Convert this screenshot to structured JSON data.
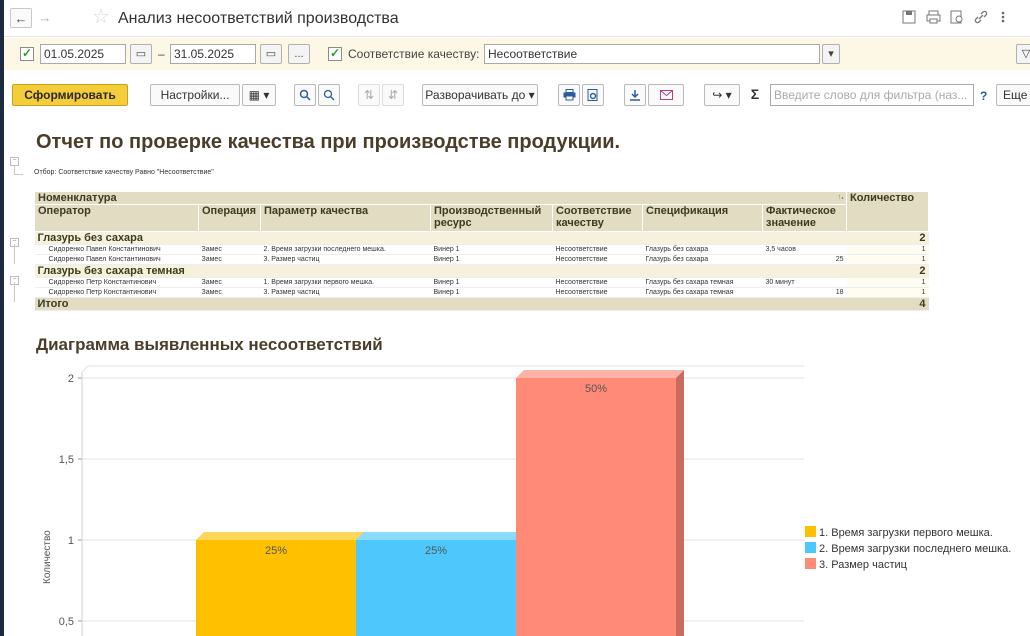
{
  "window": {
    "title": "Анализ несоответствий производства",
    "nav_back": "←",
    "nav_forward": "→",
    "star": "☆",
    "icons": [
      "save-icon",
      "print-icon",
      "preview-icon",
      "link-icon",
      "more-icon"
    ]
  },
  "filter": {
    "period_enabled": "✓",
    "date_from": "01.05.2025",
    "date_sep": "–",
    "date_to": "31.05.2025",
    "calendar_glyph": "▭",
    "period_button": "...",
    "quality_enabled": "✓",
    "quality_label": "Соответствие качеству:",
    "quality_value": "Несоответствие",
    "dropdown_glyph": "▾",
    "funnel_glyph": "▽"
  },
  "toolbar": {
    "generate_label": "Сформировать",
    "settings_label": "Настройки...",
    "variant_glyph": "▦ ▾",
    "search_glyph": "🔍",
    "search_next_glyph": "⟳",
    "sort_glyph": "⇅",
    "sort2_glyph": "⇵",
    "expand_label": "Разворачивать до",
    "expand_arrow": "▾",
    "print_glyph": "⎙",
    "preview_glyph": "🗋",
    "export_glyph": "⤓",
    "mail_glyph": "✉ ▾",
    "share_glyph": "↪ ▾",
    "sum_glyph": "Σ",
    "filter_placeholder": "Введите слово для фильтра (наз...",
    "help_label": "?",
    "more_label": "Еще"
  },
  "report": {
    "title": "Отчет по проверке качества при производстве продукции.",
    "filter_line": "Отбор:  Соответствие качеству Равно \"Несоответствие\"",
    "headers": {
      "nomenclature": "Номенклатура",
      "operator": "Оператор",
      "operation": "Операция",
      "parameter": "Параметр качества",
      "resource": "Производственный ресурс",
      "conformity": "Соответствие качеству",
      "spec": "Спецификация",
      "actual": "Фактическое значение",
      "quantity": "Количество",
      "sort_mark": "↑₁"
    },
    "groups": [
      {
        "name": "Глазурь без сахара",
        "qty": "2",
        "rows": [
          {
            "operator": "Сидоренко Павел Константинович",
            "operation": "Замес",
            "parameter": "2. Время загрузки последнего мешка.",
            "resource": "Винер 1",
            "conformity": "Несоответствие",
            "spec": "Глазурь без сахара",
            "actual": "3,5 часов",
            "qty": "1"
          },
          {
            "operator": "Сидоренко Павел Константинович",
            "operation": "Замес",
            "parameter": "3. Размер частиц",
            "resource": "Винер 1",
            "conformity": "Несоответствие",
            "spec": "Глазурь без сахара",
            "actual": "25",
            "qty": "1"
          }
        ]
      },
      {
        "name": "Глазурь без сахара темная",
        "qty": "2",
        "rows": [
          {
            "operator": "Сидоренко Петр Константинович",
            "operation": "Замес",
            "parameter": "1. Время загрузки первого мешка.",
            "resource": "Винер 1",
            "conformity": "Несоответствие",
            "spec": "Глазурь без сахара темная",
            "actual": "30 минут",
            "qty": "1"
          },
          {
            "operator": "Сидоренко Петр Константинович",
            "operation": "Замес",
            "parameter": "3. Размер частиц",
            "resource": "Винер 1",
            "conformity": "Несоответствие",
            "spec": "Глазурь без сахара темная",
            "actual": "18",
            "qty": "1"
          }
        ]
      }
    ],
    "total_label": "Итого",
    "total_qty": "4",
    "chart_title": "Диаграмма выявленных несоответствий"
  },
  "chart_data": {
    "type": "bar",
    "title": "",
    "ylabel": "Количество",
    "xlabel": "",
    "ylim": [
      0,
      2
    ],
    "yticks": [
      "0,5",
      "1",
      "1,5",
      "2"
    ],
    "grid": true,
    "legend_position": "right",
    "series": [
      {
        "name": "1. Время загрузки первого мешка.",
        "value": 1,
        "label": "25%",
        "color": "#ffc000"
      },
      {
        "name": "2. Время загрузки последнего мешка.",
        "value": 1,
        "label": "25%",
        "color": "#4dc7fc"
      },
      {
        "name": "3. Размер частиц",
        "value": 2,
        "label": "50%",
        "color": "#ff8a78"
      }
    ]
  }
}
